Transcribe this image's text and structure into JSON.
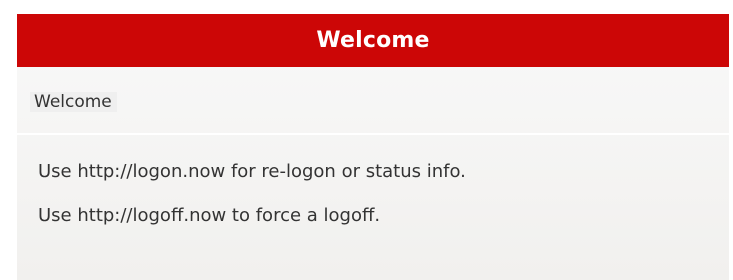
{
  "panel": {
    "title": "Welcome",
    "header_color": "#cc0606",
    "welcome_text": "Welcome",
    "lines": [
      "Use http://logon.now for re-logon or status info.",
      "Use http://logoff.now to force a logoff."
    ]
  }
}
